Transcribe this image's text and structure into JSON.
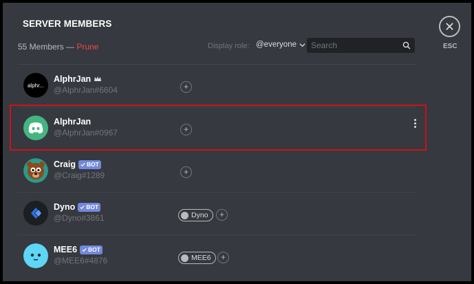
{
  "header": {
    "title": "SERVER MEMBERS",
    "member_count": "55 Members",
    "separator": "—",
    "prune_label": "Prune",
    "display_role_label": "Display role:",
    "role_value": "@everyone",
    "search_placeholder": "Search",
    "esc_label": "ESC"
  },
  "members": [
    {
      "name": "AlphrJan",
      "tag": "@AlphrJan#6604",
      "avatar_text": "alphr...",
      "owner": true
    },
    {
      "name": "AlphrJan",
      "tag": "@AlphrJan#0967",
      "selected": true
    },
    {
      "name": "Craig",
      "tag": "@Craig#1289",
      "bot": "BOT"
    },
    {
      "name": "Dyno",
      "tag": "@Dyno#3861",
      "bot": "BOT",
      "role": "Dyno"
    },
    {
      "name": "MEE6",
      "tag": "@MEE6#4876",
      "bot": "BOT",
      "role": "MEE6"
    }
  ],
  "add_role_symbol": "+",
  "colors": {
    "background": "#36393f",
    "accent_bot": "#7289da",
    "prune": "#f04747",
    "highlight": "#d0101a",
    "discord_green": "#43b581",
    "mee6_blue": "#5ed6f5"
  }
}
